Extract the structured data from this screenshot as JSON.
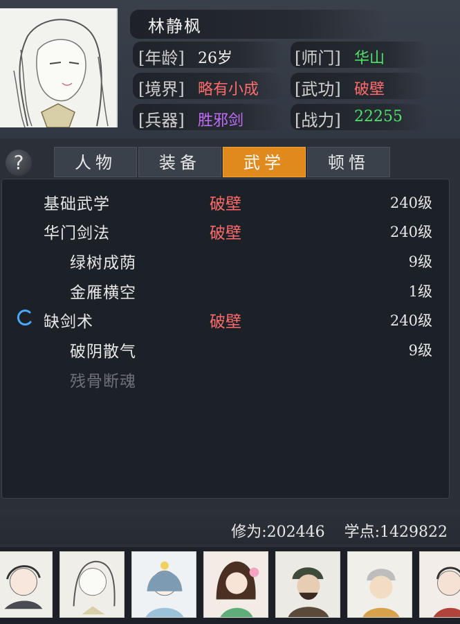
{
  "character": {
    "name": "林静枫",
    "stats": {
      "age_label": "[年龄]",
      "age_value": "26岁",
      "sect_label": "[师门]",
      "sect_value": "华山",
      "realm_label": "[境界]",
      "realm_value": "略有小成",
      "martial_label": "[武功]",
      "martial_value": "破壁",
      "weapon_label": "[兵器]",
      "weapon_value": "胜邪剑",
      "power_label": "[战力]",
      "power_value": "22255"
    }
  },
  "help": {
    "icon": "question-icon",
    "label": "?"
  },
  "tabs": [
    {
      "label": "人物",
      "active": false
    },
    {
      "label": "装备",
      "active": false
    },
    {
      "label": "武学",
      "active": true
    },
    {
      "label": "顿悟",
      "active": false
    }
  ],
  "skills": [
    {
      "name": "基础武学",
      "tier": "破壁",
      "level": "240级"
    },
    {
      "name": "华门剑法",
      "tier": "破壁",
      "level": "240级"
    },
    {
      "name": "绿树成荫",
      "tier": "",
      "level": "9级"
    },
    {
      "name": "金雁横空",
      "tier": "",
      "level": "1级"
    },
    {
      "name": "缺剑术",
      "tier": "破壁",
      "level": "240级"
    },
    {
      "name": "破阴散气",
      "tier": "",
      "level": "9级"
    },
    {
      "name": "残骨断魂",
      "tier": "",
      "level": ""
    }
  ],
  "footer": {
    "xiuwei": "修为:202446",
    "xuedian": "学点:1429822"
  },
  "colors": {
    "accent_tab": "#e08a1e",
    "tier_red": "#ff6b6b",
    "sect_green": "#4fe36b",
    "weapon_purple": "#c36bff"
  },
  "party": [
    {
      "icon": "character-portrait-1"
    },
    {
      "icon": "character-portrait-2"
    },
    {
      "icon": "character-portrait-3"
    },
    {
      "icon": "character-portrait-4"
    },
    {
      "icon": "character-portrait-5"
    },
    {
      "icon": "character-portrait-6"
    },
    {
      "icon": "character-portrait-7"
    }
  ]
}
